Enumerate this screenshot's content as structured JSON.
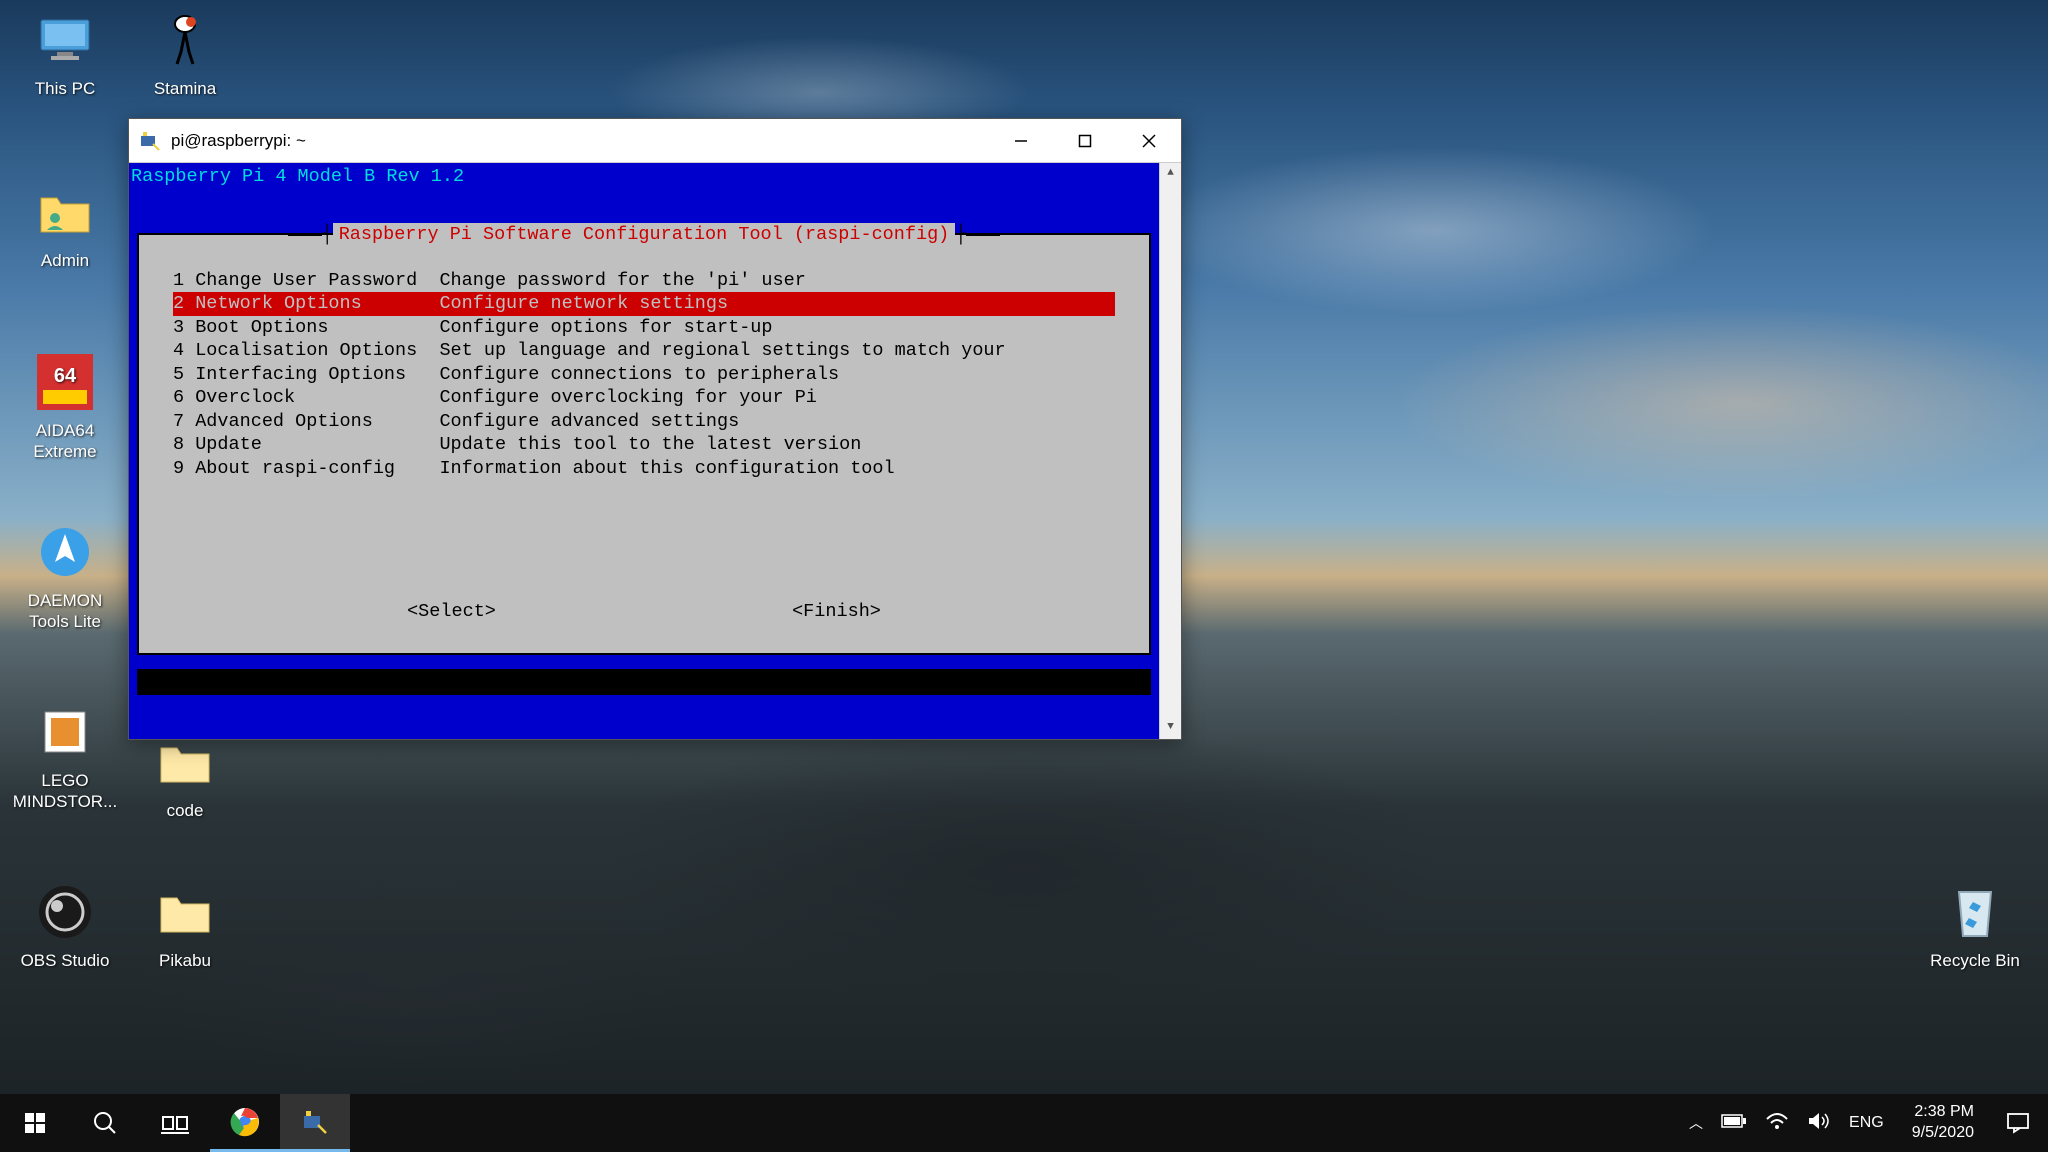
{
  "desktop_icons": [
    {
      "id": "this-pc",
      "label": "This PC"
    },
    {
      "id": "stamina",
      "label": "Stamina"
    },
    {
      "id": "admin",
      "label": "Admin"
    },
    {
      "id": "aida64",
      "label": "AIDA64 Extreme"
    },
    {
      "id": "daemon",
      "label": "DAEMON Tools Lite"
    },
    {
      "id": "lego",
      "label": "LEGO MINDSTOR..."
    },
    {
      "id": "obs",
      "label": "OBS Studio"
    },
    {
      "id": "code",
      "label": "code"
    },
    {
      "id": "pikabu",
      "label": "Pikabu"
    },
    {
      "id": "recycle",
      "label": "Recycle Bin"
    }
  ],
  "window": {
    "title": "pi@raspberrypi: ~",
    "terminal_header": "Raspberry Pi 4 Model B Rev 1.2",
    "config_title": "Raspberry Pi Software Configuration Tool (raspi-config)",
    "menu": [
      {
        "num": "1",
        "name": "Change User Password",
        "desc": "Change password for the 'pi' user",
        "selected": false
      },
      {
        "num": "2",
        "name": "Network Options",
        "desc": "Configure network settings",
        "selected": true
      },
      {
        "num": "3",
        "name": "Boot Options",
        "desc": "Configure options for start-up",
        "selected": false
      },
      {
        "num": "4",
        "name": "Localisation Options",
        "desc": "Set up language and regional settings to match your",
        "selected": false
      },
      {
        "num": "5",
        "name": "Interfacing Options",
        "desc": "Configure connections to peripherals",
        "selected": false
      },
      {
        "num": "6",
        "name": "Overclock",
        "desc": "Configure overclocking for your Pi",
        "selected": false
      },
      {
        "num": "7",
        "name": "Advanced Options",
        "desc": "Configure advanced settings",
        "selected": false
      },
      {
        "num": "8",
        "name": "Update",
        "desc": "Update this tool to the latest version",
        "selected": false
      },
      {
        "num": "9",
        "name": "About raspi-config",
        "desc": "Information about this configuration tool",
        "selected": false
      }
    ],
    "buttons": {
      "select": "<Select>",
      "finish": "<Finish>"
    }
  },
  "taskbar": {
    "lang": "ENG",
    "time": "2:38 PM",
    "date": "9/5/2020"
  }
}
